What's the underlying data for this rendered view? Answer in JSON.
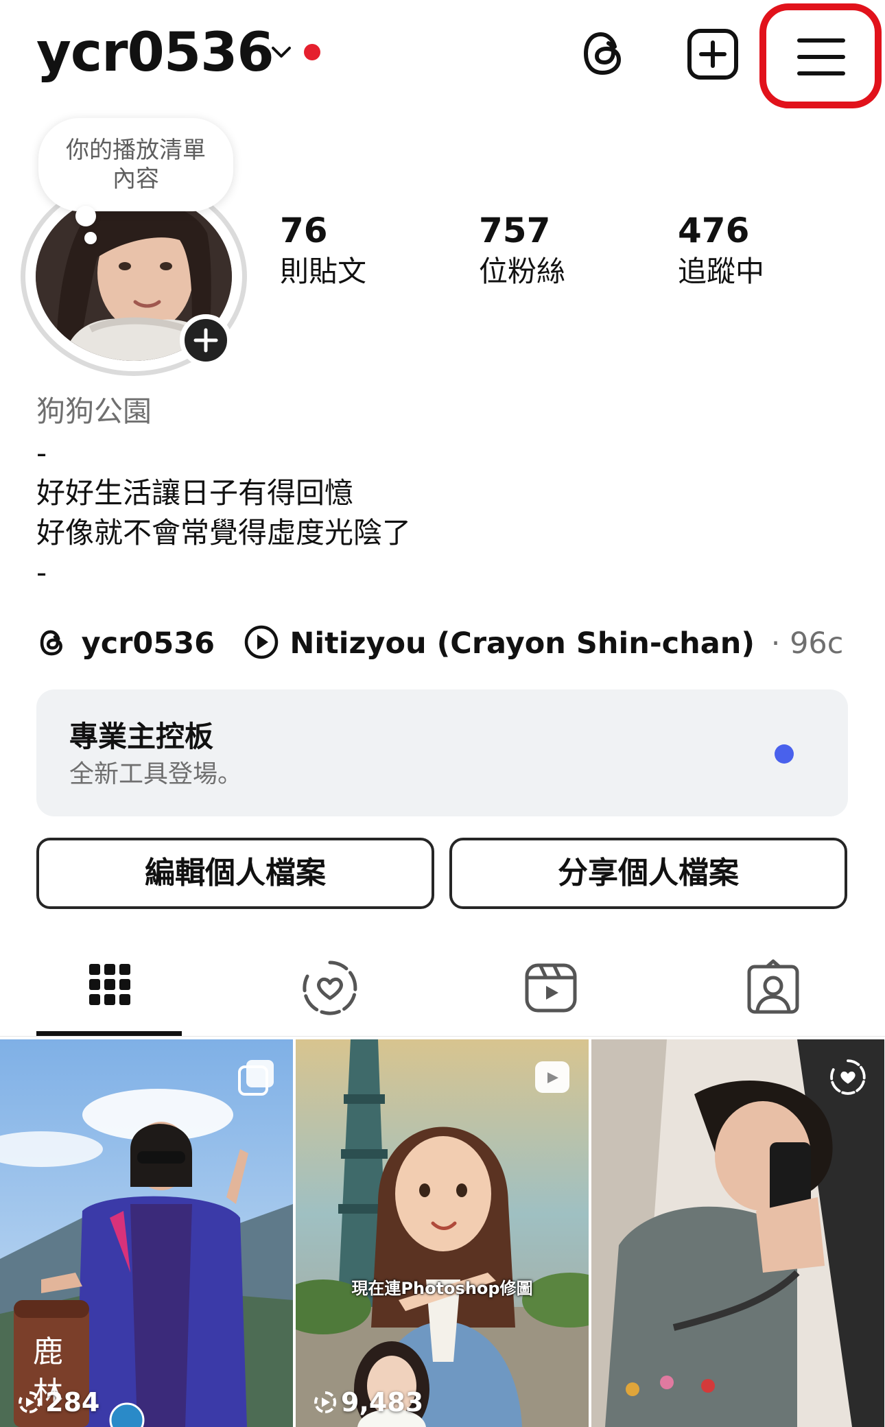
{
  "header": {
    "username": "ycr0536",
    "icons": [
      "chevron-down-icon",
      "threads-icon",
      "add-post-icon",
      "hamburger-menu-icon"
    ],
    "accent_red": "#e5202e"
  },
  "note": {
    "text": "你的播放清單內容"
  },
  "stats": [
    {
      "value": "76",
      "label": "則貼文"
    },
    {
      "value": "757",
      "label": "位粉絲"
    },
    {
      "value": "476",
      "label": "追蹤中"
    }
  ],
  "bio": {
    "name": "狗狗公園",
    "lines": [
      "-",
      "好好生活讓日子有得回憶",
      "好像就不會常覺得虛度光陰了",
      "-"
    ]
  },
  "links": {
    "threads_handle": "ycr0536",
    "music": "Nitizyou (Crayon Shin-chan)",
    "music_suffix": "· 96c"
  },
  "dashboard": {
    "title": "專業主控板",
    "subtitle": "全新工具登場。",
    "dot_color": "#4961ec"
  },
  "buttons": {
    "edit": "編輯個人檔案",
    "share": "分享個人檔案"
  },
  "tabs": [
    {
      "icon": "grid-icon",
      "active": true
    },
    {
      "icon": "highlights-heart-icon",
      "active": false
    },
    {
      "icon": "reels-icon",
      "active": false
    },
    {
      "icon": "tagged-person-icon",
      "active": false
    }
  ],
  "posts": [
    {
      "type": "carousel",
      "count": "284",
      "overlay_text": "鹿林前"
    },
    {
      "type": "reel",
      "count": "9,483",
      "caption": "現在連Photoshop修圖"
    },
    {
      "type": "highlight",
      "count": ""
    }
  ]
}
